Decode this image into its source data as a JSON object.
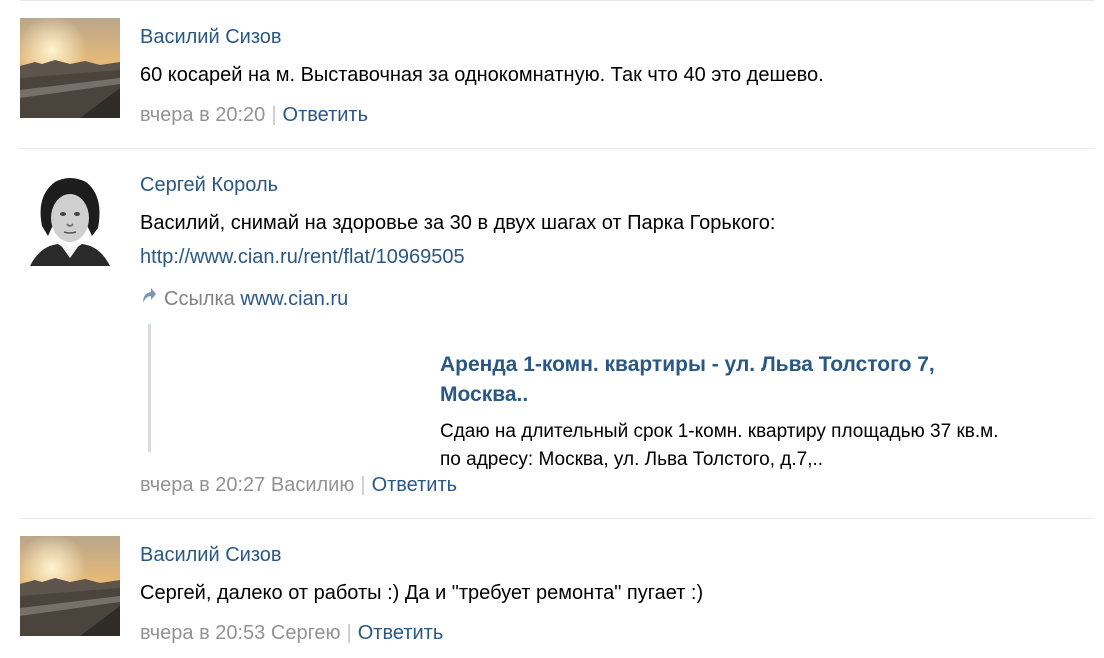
{
  "comments": [
    {
      "author": "Василий Сизов",
      "text": "60 косарей на м. Выставочная за однокомнатную. Так что 40 это дешево.",
      "time": "вчера в 20:20",
      "reply_label": "Ответить"
    },
    {
      "author": "Сергей Король",
      "text": "Василий, снимай на здоровье за 30 в двух шагах от Парка Горького:",
      "link_url": "http://www.cian.ru/rent/flat/10969505",
      "attachment": {
        "prefix": "Ссылка",
        "domain": "www.cian.ru",
        "title_line1": "Аренда 1-комн. квартиры - ул. Льва Толстого 7,",
        "title_line2": "Москва..",
        "desc_line1": "Сдаю на длительный срок 1-комн. квартиру площадью 37 кв.м.",
        "desc_line2": "по адресу: Москва, ул. Льва Толстого, д.7,.."
      },
      "time": "вчера в 20:27",
      "reply_to": "Василию",
      "reply_label": "Ответить"
    },
    {
      "author": "Василий Сизов",
      "text": "Сергей, далеко от работы :) Да и \"требует ремонта\" пугает :)",
      "time": "вчера в 20:53",
      "reply_to": "Сергею",
      "reply_label": "Ответить"
    }
  ],
  "colors": {
    "link": "#2a5885",
    "meta": "#939393",
    "separator": "#e7e8ec"
  }
}
